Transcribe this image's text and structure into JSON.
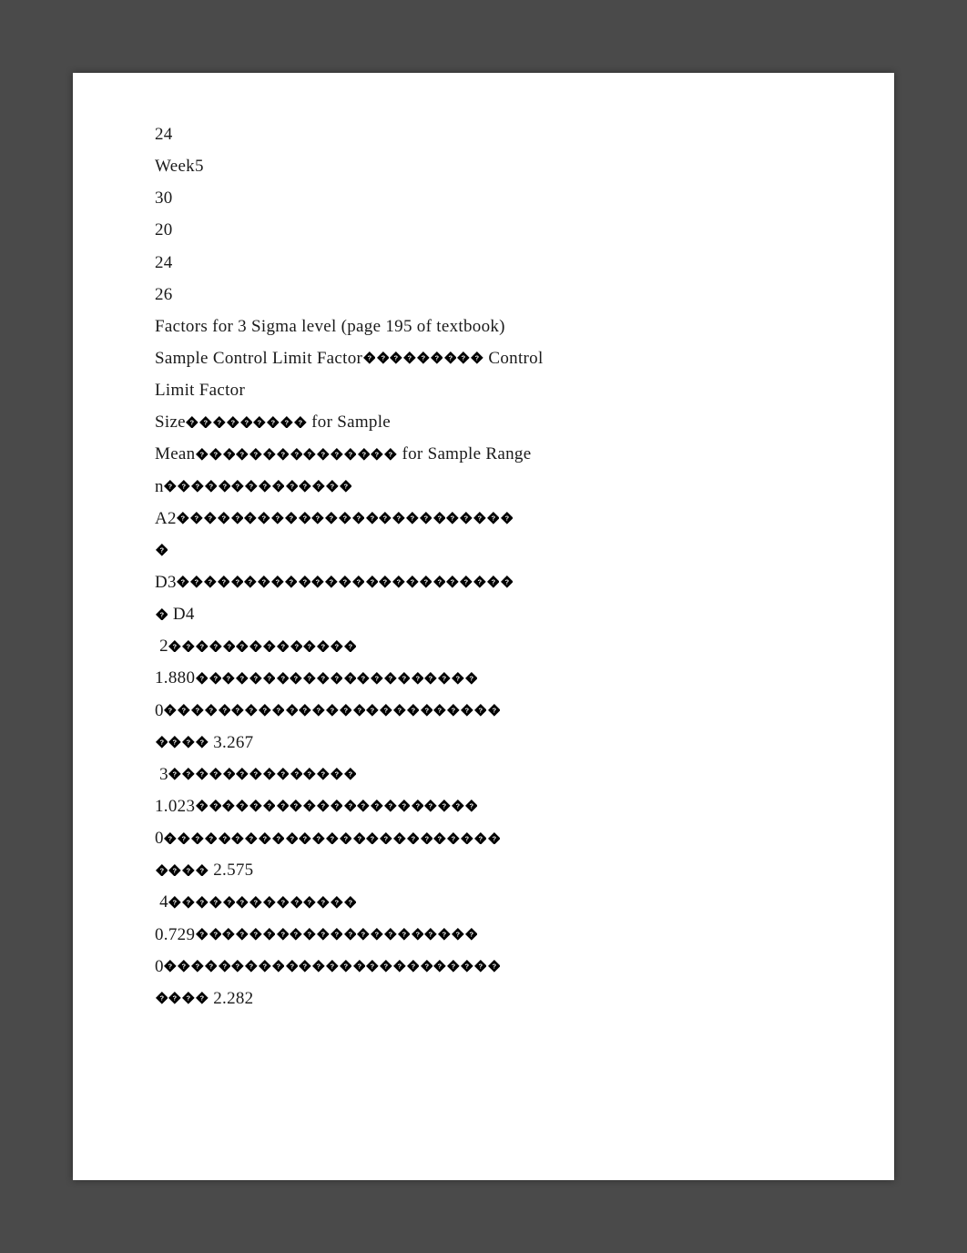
{
  "glyph_char": "◆",
  "lines": [
    {
      "text": "24",
      "glyphs_after": 0
    },
    {
      "text": "Week5",
      "glyphs_after": 0
    },
    {
      "text": "30",
      "glyphs_after": 0
    },
    {
      "text": "20",
      "glyphs_after": 0
    },
    {
      "text": "24",
      "glyphs_after": 0
    },
    {
      "text": "26",
      "glyphs_after": 0
    },
    {
      "text": "Factors for 3 Sigma level (page 195 of textbook)",
      "glyphs_after": 0
    },
    {
      "segments": [
        {
          "text": "Sample Control Limit Factor"
        },
        {
          "glyphs": 9
        },
        {
          "text": " Control"
        }
      ]
    },
    {
      "text": "Limit Factor",
      "glyphs_after": 0
    },
    {
      "segments": [
        {
          "text": "Size"
        },
        {
          "glyphs": 9
        },
        {
          "text": " for Sample"
        }
      ]
    },
    {
      "segments": [
        {
          "text": "Mean"
        },
        {
          "glyphs": 15
        },
        {
          "text": " for Sample Range"
        }
      ]
    },
    {
      "segments": [
        {
          "text": "n"
        },
        {
          "glyphs": 14
        }
      ]
    },
    {
      "segments": [
        {
          "text": "A2"
        },
        {
          "glyphs": 25
        }
      ]
    },
    {
      "segments": [
        {
          "glyphs": 1
        }
      ]
    },
    {
      "segments": [
        {
          "text": "D3"
        },
        {
          "glyphs": 25
        }
      ]
    },
    {
      "segments": [
        {
          "glyphs": 1
        },
        {
          "text": " D4"
        }
      ]
    },
    {
      "segments": [
        {
          "text": " 2"
        },
        {
          "glyphs": 14
        }
      ]
    },
    {
      "segments": [
        {
          "text": "1.880"
        },
        {
          "glyphs": 21
        }
      ]
    },
    {
      "segments": [
        {
          "text": "0"
        },
        {
          "glyphs": 25
        }
      ]
    },
    {
      "segments": [
        {
          "glyphs": 4
        },
        {
          "text": " 3.267"
        }
      ]
    },
    {
      "segments": [
        {
          "text": " 3"
        },
        {
          "glyphs": 14
        }
      ]
    },
    {
      "segments": [
        {
          "text": "1.023"
        },
        {
          "glyphs": 21
        }
      ]
    },
    {
      "segments": [
        {
          "text": "0"
        },
        {
          "glyphs": 25
        }
      ]
    },
    {
      "segments": [
        {
          "glyphs": 4
        },
        {
          "text": " 2.575"
        }
      ]
    },
    {
      "segments": [
        {
          "text": " 4"
        },
        {
          "glyphs": 14
        }
      ]
    },
    {
      "segments": [
        {
          "text": "0.729"
        },
        {
          "glyphs": 21
        }
      ]
    },
    {
      "segments": [
        {
          "text": "0"
        },
        {
          "glyphs": 25
        }
      ]
    },
    {
      "segments": [
        {
          "glyphs": 4
        },
        {
          "text": " 2.282"
        }
      ]
    }
  ],
  "chart_data": {
    "type": "table",
    "title": "Factors for 3 Sigma level (page 195 of textbook)",
    "columns": [
      "Sample Size n",
      "Control Limit Factor for Sample Mean A2",
      "Control Limit Factor for Sample Range D3",
      "Control Limit Factor for Sample Range D4"
    ],
    "rows": [
      {
        "n": 2,
        "A2": 1.88,
        "D3": 0,
        "D4": 3.267
      },
      {
        "n": 3,
        "A2": 1.023,
        "D3": 0,
        "D4": 2.575
      },
      {
        "n": 4,
        "A2": 0.729,
        "D3": 0,
        "D4": 2.282
      }
    ],
    "preceding_values": {
      "label": "24 / Week5",
      "values": [
        24,
        "Week5",
        30,
        20,
        24,
        26
      ]
    }
  }
}
